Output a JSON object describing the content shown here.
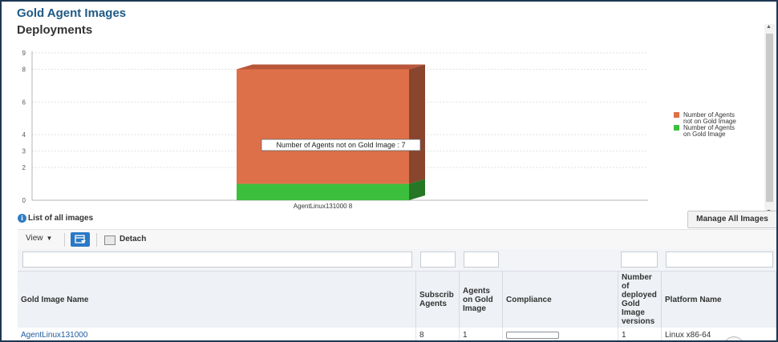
{
  "page": {
    "title": "Gold Agent Images",
    "section_title": "Deployments"
  },
  "chart_data": {
    "type": "bar",
    "stacked": true,
    "categories": [
      "AgentLinux131000 8"
    ],
    "series": [
      {
        "name": "Number of Agents on Gold Image",
        "values": [
          1
        ],
        "color": "#3cbf3c"
      },
      {
        "name": "Number of Agents not on Gold Image",
        "values": [
          7
        ],
        "color": "#dd7048"
      }
    ],
    "y_ticks": [
      0,
      2,
      3,
      4,
      6,
      8,
      9
    ],
    "ylim": [
      0,
      9
    ],
    "grid": true,
    "legend_position": "right",
    "legend": [
      {
        "line1": "Number of Agents",
        "line2": "not on Gold Image",
        "color": "#dd7048"
      },
      {
        "line1": "Number of Agents",
        "line2": "on Gold Image",
        "color": "#3cbf3c"
      }
    ],
    "tooltip": "Number of Agents not on Gold Image : 7"
  },
  "list": {
    "label": "List of all images",
    "info_icon": "info-icon",
    "manage_button": "Manage All Images"
  },
  "toolbar": {
    "view_label": "View",
    "freeze_icon": "freeze-icon",
    "detach_label": "Detach"
  },
  "table": {
    "columns": [
      {
        "lines": [
          "Gold Image Name"
        ]
      },
      {
        "lines": [
          "Subscrib",
          "Agents"
        ]
      },
      {
        "lines": [
          "Agents",
          "on Gold",
          "Image"
        ]
      },
      {
        "lines": [
          "Compliance"
        ]
      },
      {
        "lines": [
          "Number",
          "of",
          "deployed",
          "Gold",
          "Image",
          "versions"
        ]
      },
      {
        "lines": [
          "Platform Name"
        ]
      }
    ],
    "rows": [
      {
        "name": "AgentLinux131000",
        "subscribed": "8",
        "on_gold": "1",
        "compliance": 0,
        "deployed_versions": "1",
        "platform": "Linux x86-64"
      }
    ]
  }
}
